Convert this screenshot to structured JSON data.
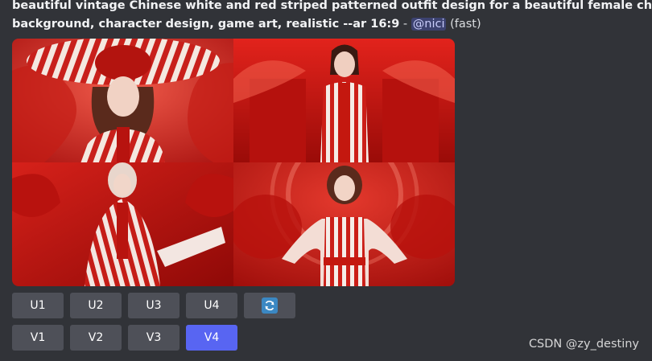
{
  "message": {
    "prompt_line1": "beautiful vintage Chinese white and red striped patterned outfit design for a beautiful female character on a red",
    "prompt_line2": "background, character design, game art, realistic --ar 16:9",
    "separator": " - ",
    "mention": "@nici",
    "speed": "(fast)"
  },
  "images": [
    {
      "label": "image-1"
    },
    {
      "label": "image-2"
    },
    {
      "label": "image-3"
    },
    {
      "label": "image-4"
    }
  ],
  "upscale_buttons": [
    "U1",
    "U2",
    "U3",
    "U4"
  ],
  "reroll_icon": "reroll-icon",
  "variation_buttons": [
    "V1",
    "V2",
    "V3",
    "V4"
  ],
  "selected_variation": "V4",
  "watermark": "CSDN @zy_destiny",
  "colors": {
    "background": "#313338",
    "button": "#4e5058",
    "button_selected": "#5865f2",
    "mention_bg": "#3c4270"
  }
}
